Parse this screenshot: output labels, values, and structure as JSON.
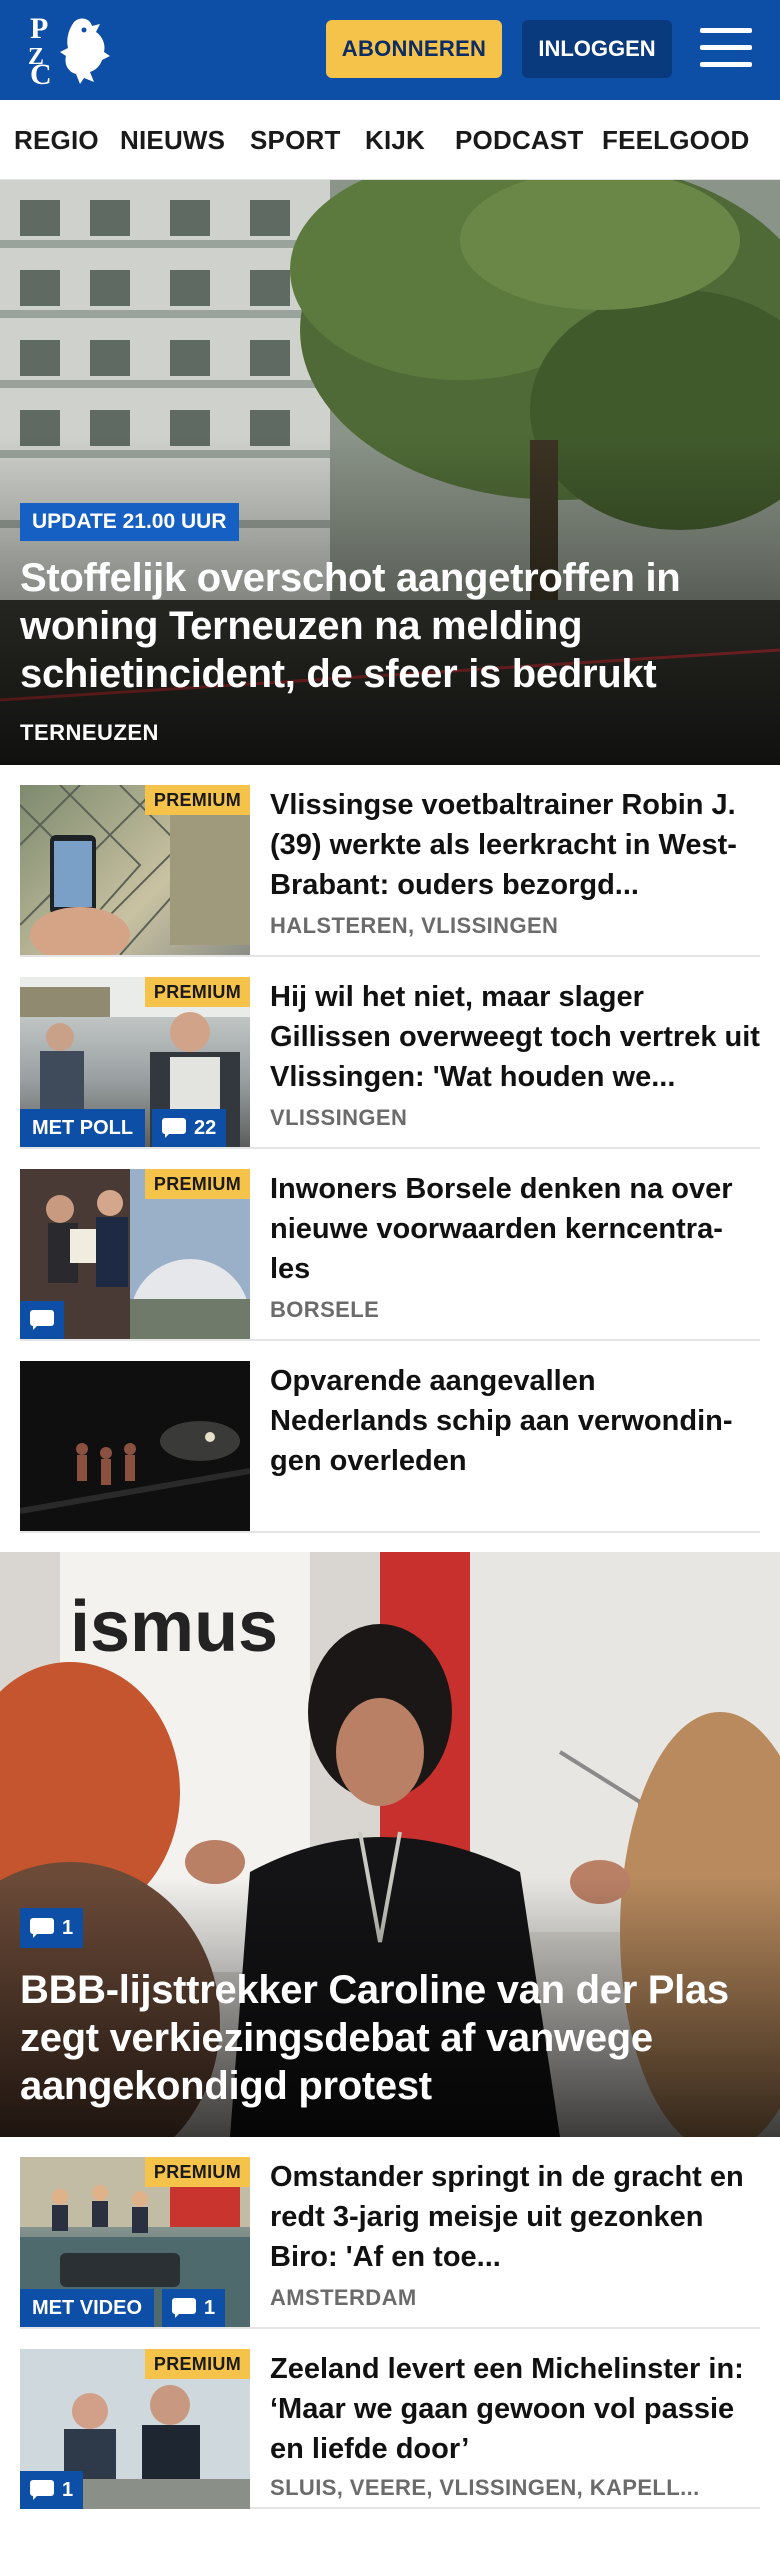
{
  "header": {
    "logo_letters": [
      "P",
      "Z",
      "C"
    ],
    "subscribe_label": "ABONNEREN",
    "login_label": "INLOGGEN",
    "brand_color": "#0d4ea6",
    "accent_color": "#f5c24a"
  },
  "nav": {
    "items": [
      "REGIO",
      "NIEUWS",
      "SPORT",
      "KIJK",
      "PODCAST",
      "FEELGOOD"
    ]
  },
  "hero_top": {
    "badge": "UPDATE 21.00 UUR",
    "title": "Stoffelijk overschot aangetroffen in woning Terneuzen na melding schietincident, de sfeer is bedrukt",
    "location": "TERNEUZEN"
  },
  "articles_a": [
    {
      "premium": "PREMIUM",
      "title": "Vlissingse voetbaltrainer Robin J. (39) werkte als leerkracht in West-Brabant: ouders bezorgd...",
      "location": "HALSTEREN, VLISSINGEN"
    },
    {
      "premium": "PREMIUM",
      "tag": "MET POLL",
      "comments": "22",
      "title": "Hij wil het niet, maar slager Gillissen overweegt toch vertrek uit Vlissingen: 'Wat houden we...",
      "location": "VLISSINGEN"
    },
    {
      "premium": "PREMIUM",
      "title": "Inwoners Borsele denken na over nieuwe voorwaarden kerncentra-les",
      "location": "BORSELE"
    },
    {
      "title": "Opvarende aangevallen Nederlands schip aan verwondin-gen overleden"
    }
  ],
  "hero_mid": {
    "comments": "1",
    "title": "BBB-lijsttrekker Caroline van der Plas zegt verkiezingsdebat af vanwege aangekondigd protest",
    "sign_text": "ismus"
  },
  "articles_b": [
    {
      "premium": "PREMIUM",
      "tag": "MET VIDEO",
      "comments": "1",
      "title": "Omstander springt in de gracht en redt 3-jarig meisje uit gezonken Biro: 'Af en toe...",
      "location": "AMSTERDAM"
    },
    {
      "premium": "PREMIUM",
      "comments": "1",
      "title": "Zeeland levert een Michelinster in: ‘Maar we gaan gewoon vol passie en liefde door’",
      "location": "SLUIS, VEERE, VLISSINGEN, KAPELL..."
    }
  ]
}
